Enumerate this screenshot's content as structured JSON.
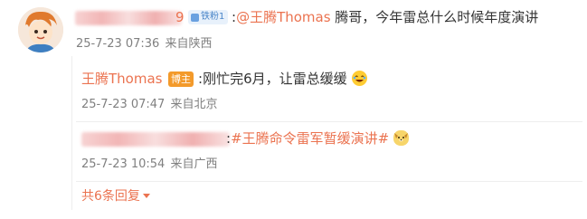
{
  "comment": {
    "username_suffix": "9",
    "fan_badge": "铁粉1",
    "separator": ":",
    "mention": "@王腾Thomas",
    "text": " 腾哥，今年雷总什么时候年度演讲",
    "timestamp": "25-7-23 07:36",
    "source": "来自陕西"
  },
  "replies": [
    {
      "username": "王腾Thomas",
      "badge": "博主",
      "separator": ":",
      "text": "刚忙完6月，让雷总缓缓",
      "emoji": "laughing-emoji",
      "timestamp": "25-7-23 07:47",
      "source": "来自北京"
    },
    {
      "separator": ":",
      "hashtag": "#王腾命令雷军暂缓演讲#",
      "emoji": "dog-emoji",
      "timestamp": "25-7-23 10:54",
      "source": "来自广西"
    }
  ],
  "footer": {
    "more_label": "共6条回复"
  },
  "colors": {
    "accent": "#eb7350",
    "meta": "#808080",
    "host_badge": "#f39a2b",
    "fan_badge": "#4a86c9"
  }
}
